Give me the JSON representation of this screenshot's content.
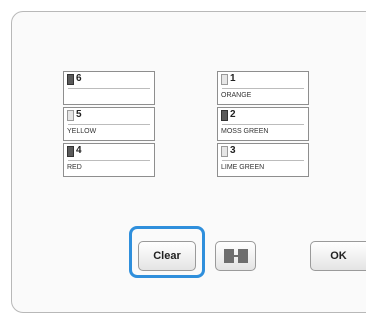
{
  "needle_bars": [
    {
      "number": "6",
      "color_name": "",
      "spool": "filled"
    },
    {
      "number": "5",
      "color_name": "YELLOW",
      "spool": "empty"
    },
    {
      "number": "4",
      "color_name": "RED",
      "spool": "filled"
    },
    {
      "number": "1",
      "color_name": "ORANGE",
      "spool": "empty"
    },
    {
      "number": "2",
      "color_name": "MOSS GREEN",
      "spool": "filled"
    },
    {
      "number": "3",
      "color_name": "LIME GREEN",
      "spool": "empty"
    }
  ],
  "buttons": {
    "clear_label": "Clear",
    "swap_icon": "swap-spools-icon",
    "ok_label": "OK"
  },
  "colors": {
    "focus_ring": "#2f8fdc"
  }
}
